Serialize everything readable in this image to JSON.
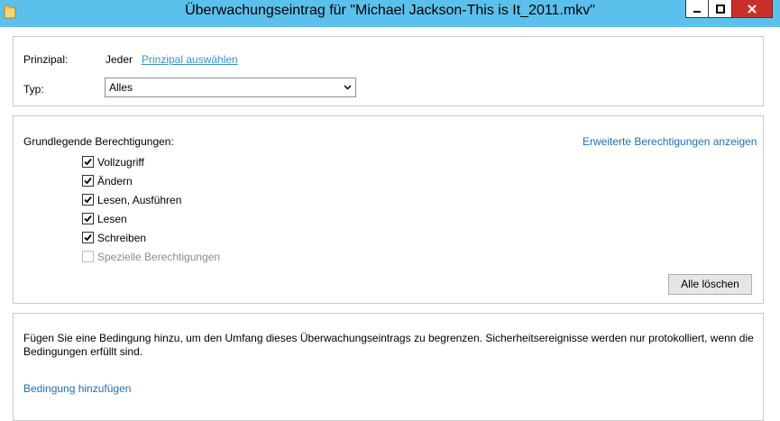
{
  "window": {
    "title": "Überwachungseintrag für \"Michael Jackson-This is It_2011.mkv\"",
    "controls": {
      "minimize": "minimize",
      "maximize": "maximize",
      "close": "close"
    }
  },
  "principal": {
    "label": "Prinzipal:",
    "value": "Jeder",
    "select_link": "Prinzipal auswählen"
  },
  "type": {
    "label": "Typ:",
    "selected": "Alles"
  },
  "permissions": {
    "heading": "Grundlegende Berechtigungen:",
    "advanced_link": "Erweiterte Berechtigungen anzeigen",
    "items": [
      {
        "label": "Vollzugriff",
        "checked": true,
        "enabled": true
      },
      {
        "label": "Ändern",
        "checked": true,
        "enabled": true
      },
      {
        "label": "Lesen, Ausführen",
        "checked": true,
        "enabled": true
      },
      {
        "label": "Lesen",
        "checked": true,
        "enabled": true
      },
      {
        "label": "Schreiben",
        "checked": true,
        "enabled": true
      },
      {
        "label": "Spezielle Berechtigungen",
        "checked": false,
        "enabled": false
      }
    ],
    "clear_button": "Alle löschen"
  },
  "condition": {
    "description": "Fügen Sie eine Bedingung hinzu, um den Umfang dieses Überwachungseintrags zu begrenzen. Sicherheitsereignisse werden nur protokolliert, wenn die Bedingungen erfüllt sind.",
    "add_link": "Bedingung hinzufügen"
  },
  "colors": {
    "titlebar": "#5bc0ec",
    "close_button": "#c7312a",
    "link": "#1e6fb5"
  }
}
